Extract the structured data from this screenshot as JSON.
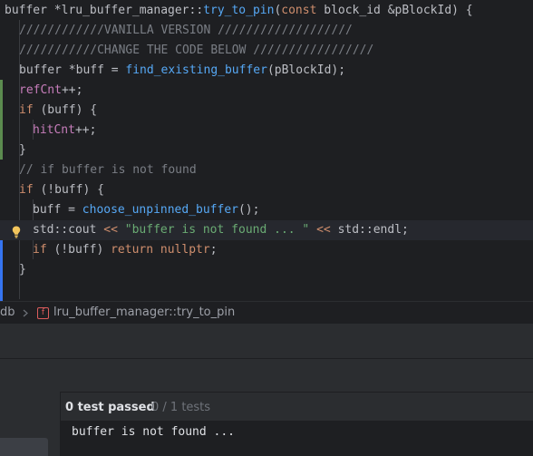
{
  "editor": {
    "lines": [
      {
        "t": "sig"
      },
      {
        "t": "comment1",
        "text": "////////////VANILLA VERSION ///////////////////"
      },
      {
        "t": "comment2",
        "text": "///////////CHANGE THE CODE BELOW /////////////////"
      },
      {
        "t": "l3"
      },
      {
        "t": "l4"
      },
      {
        "t": "l5"
      },
      {
        "t": "l6"
      },
      {
        "t": "l7"
      },
      {
        "t": "comment3",
        "text": "// if buffer is not found"
      },
      {
        "t": "l9"
      },
      {
        "t": "l10"
      },
      {
        "t": "l11"
      },
      {
        "t": "l12"
      },
      {
        "t": "l13"
      }
    ],
    "tokens": {
      "sig_type": "buffer",
      "sig_star": " *",
      "sig_class": "lru_buffer_manager",
      "sig_sep": "::",
      "sig_fn": "try_to_pin",
      "sig_paren": "(",
      "sig_const": "const",
      "sig_param_type": " block_id ",
      "sig_param": "&pBlockId) {",
      "l3_a": "buffer *buff = ",
      "l3_fn": "find_existing_buffer",
      "l3_b": "(pBlockId);",
      "l4_field": "refCnt",
      "l4_op": "++;",
      "l5_kw": "if",
      "l5_rest": " (buff) {",
      "l6_field": "hitCnt",
      "l6_op": "++;",
      "l7": "}",
      "l9_kw": "if",
      "l9_rest": " (!buff) {",
      "l10_a": "buff = ",
      "l10_fn": "choose_unpinned_buffer",
      "l10_b": "();",
      "l11_ns": "std::cout ",
      "l11_op1": "<< ",
      "l11_str": "\"buffer is not found ... \"",
      "l11_op2": " << ",
      "l11_end": "std::endl;",
      "l12_kw": "if",
      "l12_mid": " (!buff) ",
      "l12_ret": "return",
      "l12_null": " nullptr",
      "l12_end": ";",
      "l13": "}"
    }
  },
  "breadcrumb": {
    "project": "db",
    "fn_icon_letter": "f",
    "function": "lru_buffer_manager::try_to_pin"
  },
  "tests": {
    "status": "0 test passed",
    "count": "0 / 1 tests"
  },
  "console": {
    "output": "buffer is not found ..."
  },
  "colors": {
    "background": "#1e1f22",
    "keyword": "#cf8e6d",
    "function": "#56a8f5",
    "field": "#c77dbb",
    "string": "#6aab73",
    "comment": "#7a7e85",
    "vcs_added": "#5b8b4f",
    "vcs_modified": "#3574f0",
    "bulb": "#f2c55c"
  },
  "icons": {
    "bulb": "lightbulb-icon",
    "chevron": "chevron-right-icon",
    "function": "function-icon"
  }
}
